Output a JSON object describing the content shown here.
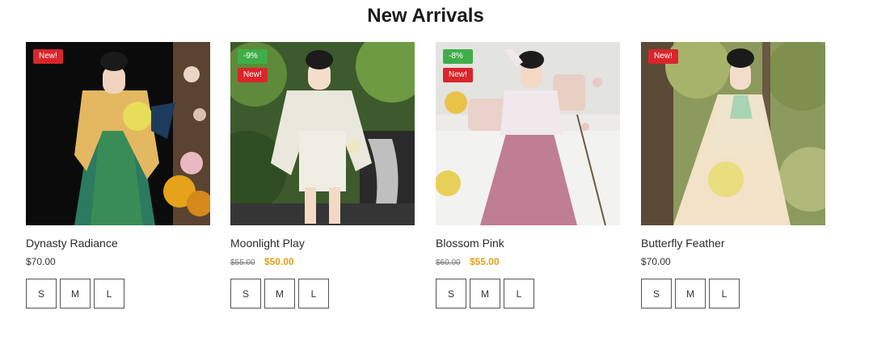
{
  "section": {
    "title": "New Arrivals"
  },
  "products": [
    {
      "name": "Dynasty Radiance",
      "price": "$70.00",
      "badges": [
        {
          "type": "new",
          "label": "New!"
        }
      ],
      "sizes": [
        "S",
        "M",
        "L"
      ]
    },
    {
      "name": "Moonlight Play",
      "old_price": "$55.00",
      "sale_price": "$50.00",
      "badges": [
        {
          "type": "sale",
          "label": "-9%"
        },
        {
          "type": "new",
          "label": "New!"
        }
      ],
      "sizes": [
        "S",
        "M",
        "L"
      ]
    },
    {
      "name": "Blossom Pink",
      "old_price": "$60.00",
      "sale_price": "$55.00",
      "badges": [
        {
          "type": "sale",
          "label": "-8%"
        },
        {
          "type": "new",
          "label": "New!"
        }
      ],
      "sizes": [
        "S",
        "M",
        "L"
      ]
    },
    {
      "name": "Butterfly Feather",
      "price": "$70.00",
      "badges": [
        {
          "type": "new",
          "label": "New!"
        }
      ],
      "sizes": [
        "S",
        "M",
        "L"
      ]
    }
  ],
  "colors": {
    "new_badge": "#d9252b",
    "sale_badge": "#3fae49",
    "sale_price": "#e0a01a"
  }
}
